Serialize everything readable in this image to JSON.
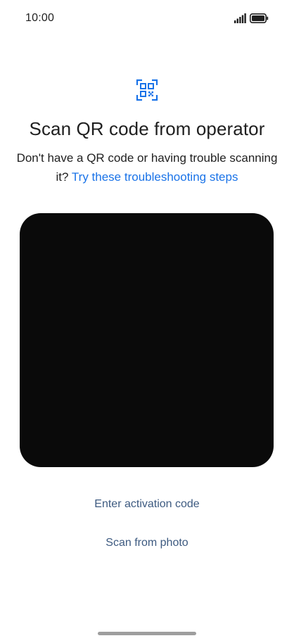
{
  "status_bar": {
    "time": "10:00",
    "icons": [
      "signal-icon",
      "battery-icon"
    ]
  },
  "header": {
    "icon": "qr-code-icon",
    "title": "Scan QR code from operator",
    "description_text": "Don't have a QR code or having trouble scanning it? ",
    "description_link": "Try these troubleshooting steps"
  },
  "actions": {
    "enter_code_label": "Enter activation code",
    "scan_photo_label": "Scan from photo"
  },
  "colors": {
    "accent_link": "#1a73e8",
    "action_text": "#3d5a80",
    "viewfinder_bg": "#0a0a0a",
    "qr_icon": "#1a73e8"
  }
}
